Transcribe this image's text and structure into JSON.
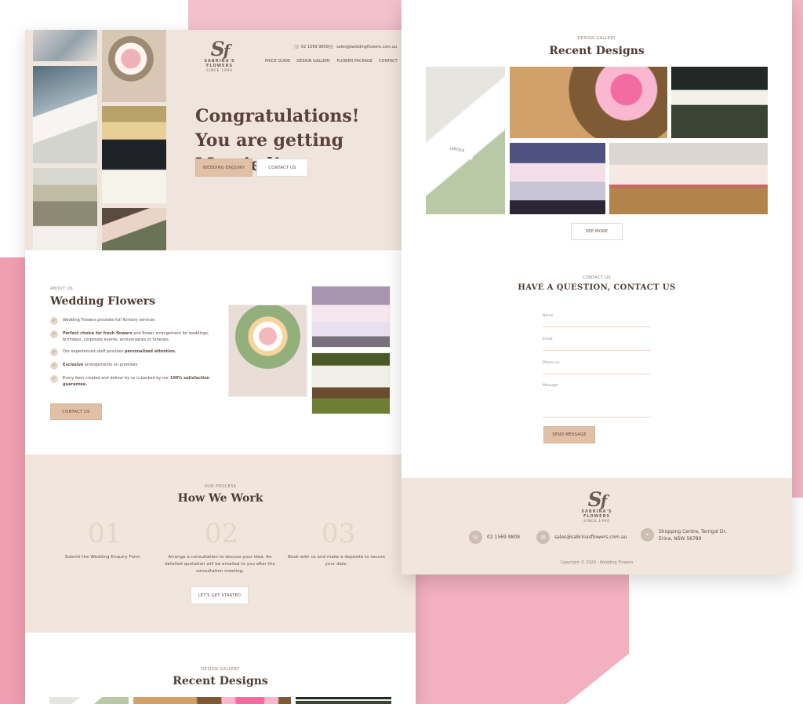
{
  "brand": {
    "name": "SABRINA'S FLOWERS",
    "since": "SINCE 1990"
  },
  "header": {
    "phone": "02 1569 9809",
    "email": "sales@weddingflowers.com.au",
    "menu": [
      "PRICE GUIDE",
      "DESIGN GALLERY",
      "FLOWER PACKAGE",
      "CONTACT"
    ]
  },
  "hero": {
    "title_line1": "Congratulations!",
    "title_line2": "You are getting Married!",
    "primary_button": "WEDDING ENQUIRY",
    "secondary_button": "CONTACT US"
  },
  "about": {
    "eyebrow": "ABOUT US",
    "title": "Wedding Flowers",
    "items": [
      {
        "text": "Wedding Flowers provides full floristry services"
      },
      {
        "bold": "Perfect choice for fresh flowers",
        "text": " and flower arrangement for weddings, birthdays, corporate events, anniversaries or funerals."
      },
      {
        "text": "Our experienced staff provides ",
        "bold": "personalized attention."
      },
      {
        "bold": "Exclusive",
        "text": " arrangements on premises"
      },
      {
        "text": "Every item created and deliver by us is backed by our ",
        "bold": "100% satisfaction guarantee."
      }
    ],
    "button": "CONTACT US"
  },
  "process": {
    "eyebrow": "OUR PROCESS",
    "title": "How We Work",
    "steps": [
      {
        "num": "01",
        "text": "Submit the Wedding Enquiry Form."
      },
      {
        "num": "02",
        "text": "Arrange a consultation to discuss your idea. An detailed quotation will be emailed to you after the consultation meeting."
      },
      {
        "num": "03",
        "text": "Book with us and make a deposite to secure your date."
      }
    ],
    "button": "LET'S GET STARTED"
  },
  "gallery_left": {
    "eyebrow": "DESIGN GALLERY",
    "title": "Recent Designs"
  },
  "gallery_right": {
    "eyebrow": "DESIGN GALLERY",
    "title": "Recent Designs",
    "button": "SEE MORE",
    "sign_label": "LIROSA"
  },
  "contact": {
    "eyebrow": "CONTACT US",
    "title": "HAVE A QUESTION, CONTACT US",
    "fields": [
      "Name",
      "Email",
      "Phone no.",
      "Message"
    ],
    "submit": "SEND MESSAGE"
  },
  "footer": {
    "phone": "02 1569 9809",
    "email": "sales@sabrinasflowers.com.au",
    "address_line1": "Shopping Centre, Terrigal Dr,",
    "address_line2": "Erina, NSW 56789",
    "copyright": "Copyright © 2020 - Wedding Flowers"
  },
  "colors": {
    "pink_background": "#f4b5c2",
    "beige": "#f1e6dc",
    "accent_button": "#e0c0a6",
    "text": "#4a3b33"
  },
  "icons": [
    "phone-icon",
    "email-icon",
    "location-icon",
    "check-icon"
  ]
}
